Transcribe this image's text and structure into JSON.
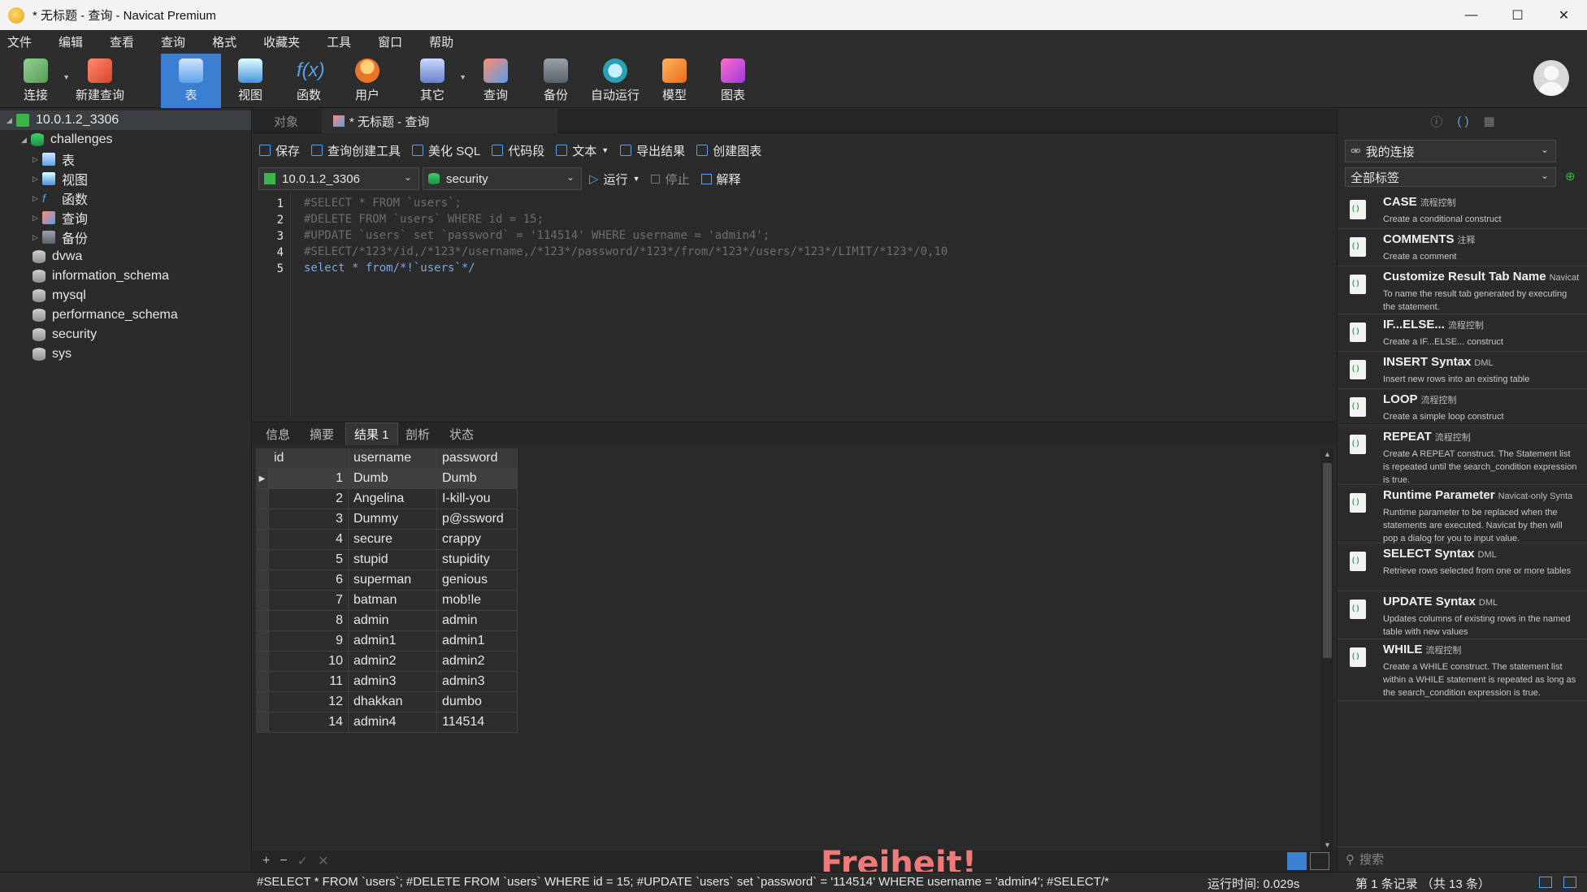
{
  "window": {
    "title": "* 无标题 - 查询 - Navicat Premium",
    "controls": [
      "minimize",
      "maximize",
      "close"
    ]
  },
  "menu": [
    "文件",
    "编辑",
    "查看",
    "查询",
    "格式",
    "收藏夹",
    "工具",
    "窗口",
    "帮助"
  ],
  "toolbar": {
    "items": [
      "连接",
      "新建查询",
      "表",
      "视图",
      "函数",
      "用户",
      "其它",
      "查询",
      "备份",
      "自动运行",
      "模型",
      "图表"
    ],
    "active": "表"
  },
  "tree": {
    "connection": "10.0.1.2_3306",
    "databases": [
      "challenges",
      "dvwa",
      "information_schema",
      "mysql",
      "performance_schema",
      "security",
      "sys"
    ],
    "challenges_children": [
      "表",
      "视图",
      "函数",
      "查询",
      "备份"
    ]
  },
  "tabs": {
    "objects": "对象",
    "query": "* 无标题 - 查询"
  },
  "editor_toolbar": [
    "保存",
    "查询创建工具",
    "美化 SQL",
    "代码段",
    "文本",
    "导出结果",
    "创建图表"
  ],
  "selectors": {
    "connection": "10.0.1.2_3306",
    "database": "security"
  },
  "run": {
    "run": "运行",
    "stop": "停止",
    "explain": "解释"
  },
  "sql_lines": [
    "#SELECT * FROM `users`;",
    "#DELETE FROM `users` WHERE id = 15;",
    "#UPDATE `users` set `password` = '114514' WHERE username = 'admin4';",
    "#SELECT/*123*/id,/*123*/username,/*123*/password/*123*/from/*123*/users/*123*/LIMIT/*123*/0,10",
    "select * from/*!`users`*/"
  ],
  "result_tabs": [
    "信息",
    "摘要",
    "结果 1",
    "剖析",
    "状态"
  ],
  "result_active": "结果 1",
  "grid": {
    "columns": [
      "id",
      "username",
      "password"
    ],
    "rows": [
      [
        "1",
        "Dumb",
        "Dumb"
      ],
      [
        "2",
        "Angelina",
        "I-kill-you"
      ],
      [
        "3",
        "Dummy",
        "p@ssword"
      ],
      [
        "4",
        "secure",
        "crappy"
      ],
      [
        "5",
        "stupid",
        "stupidity"
      ],
      [
        "6",
        "superman",
        "genious"
      ],
      [
        "7",
        "batman",
        "mob!le"
      ],
      [
        "8",
        "admin",
        "admin"
      ],
      [
        "9",
        "admin1",
        "admin1"
      ],
      [
        "10",
        "admin2",
        "admin2"
      ],
      [
        "11",
        "admin3",
        "admin3"
      ],
      [
        "12",
        "dhakkan",
        "dumbo"
      ],
      [
        "14",
        "admin4",
        "114514"
      ]
    ]
  },
  "watermark": "Freiheit!",
  "status": {
    "sql": "#SELECT * FROM `users`; #DELETE FROM `users` WHERE id = 15; #UPDATE `users` set `password` = '114514' WHERE username = 'admin4'; #SELECT/*",
    "time": "运行时间: 0.029s",
    "records": "第 1 条记录 （共 13 条）"
  },
  "right_panel": {
    "connection": "我的连接",
    "tags": "全部标签",
    "search_placeholder": "搜索",
    "snippets": [
      {
        "name": "CASE",
        "tag": "流程控制",
        "desc": "Create a conditional construct"
      },
      {
        "name": "COMMENTS",
        "tag": "注释",
        "desc": "Create a comment"
      },
      {
        "name": "Customize Result Tab Name",
        "tag": "Navicat",
        "desc": "To name the result tab generated by executing the statement."
      },
      {
        "name": "IF...ELSE...",
        "tag": "流程控制",
        "desc": "Create a IF...ELSE... construct"
      },
      {
        "name": "INSERT Syntax",
        "tag": "DML",
        "desc": "Insert new rows into an existing table"
      },
      {
        "name": "LOOP",
        "tag": "流程控制",
        "desc": "Create a simple loop construct"
      },
      {
        "name": "REPEAT",
        "tag": "流程控制",
        "desc": "Create A REPEAT construct. The Statement list is repeated until the search_condition expression is true."
      },
      {
        "name": "Runtime Parameter",
        "tag": "Navicat-only Synta",
        "desc": "Runtime parameter to be replaced when the statements are executed. Navicat by then will pop a dialog for you to input value."
      },
      {
        "name": "SELECT Syntax",
        "tag": "DML",
        "desc": "Retrieve rows selected from one or more tables"
      },
      {
        "name": "UPDATE Syntax",
        "tag": "DML",
        "desc": "Updates columns of existing rows in the named table with new values"
      },
      {
        "name": "WHILE",
        "tag": "流程控制",
        "desc": "Create a WHILE construct. The statement list within a WHILE statement is repeated as long as the search_condition expression is true."
      }
    ]
  }
}
